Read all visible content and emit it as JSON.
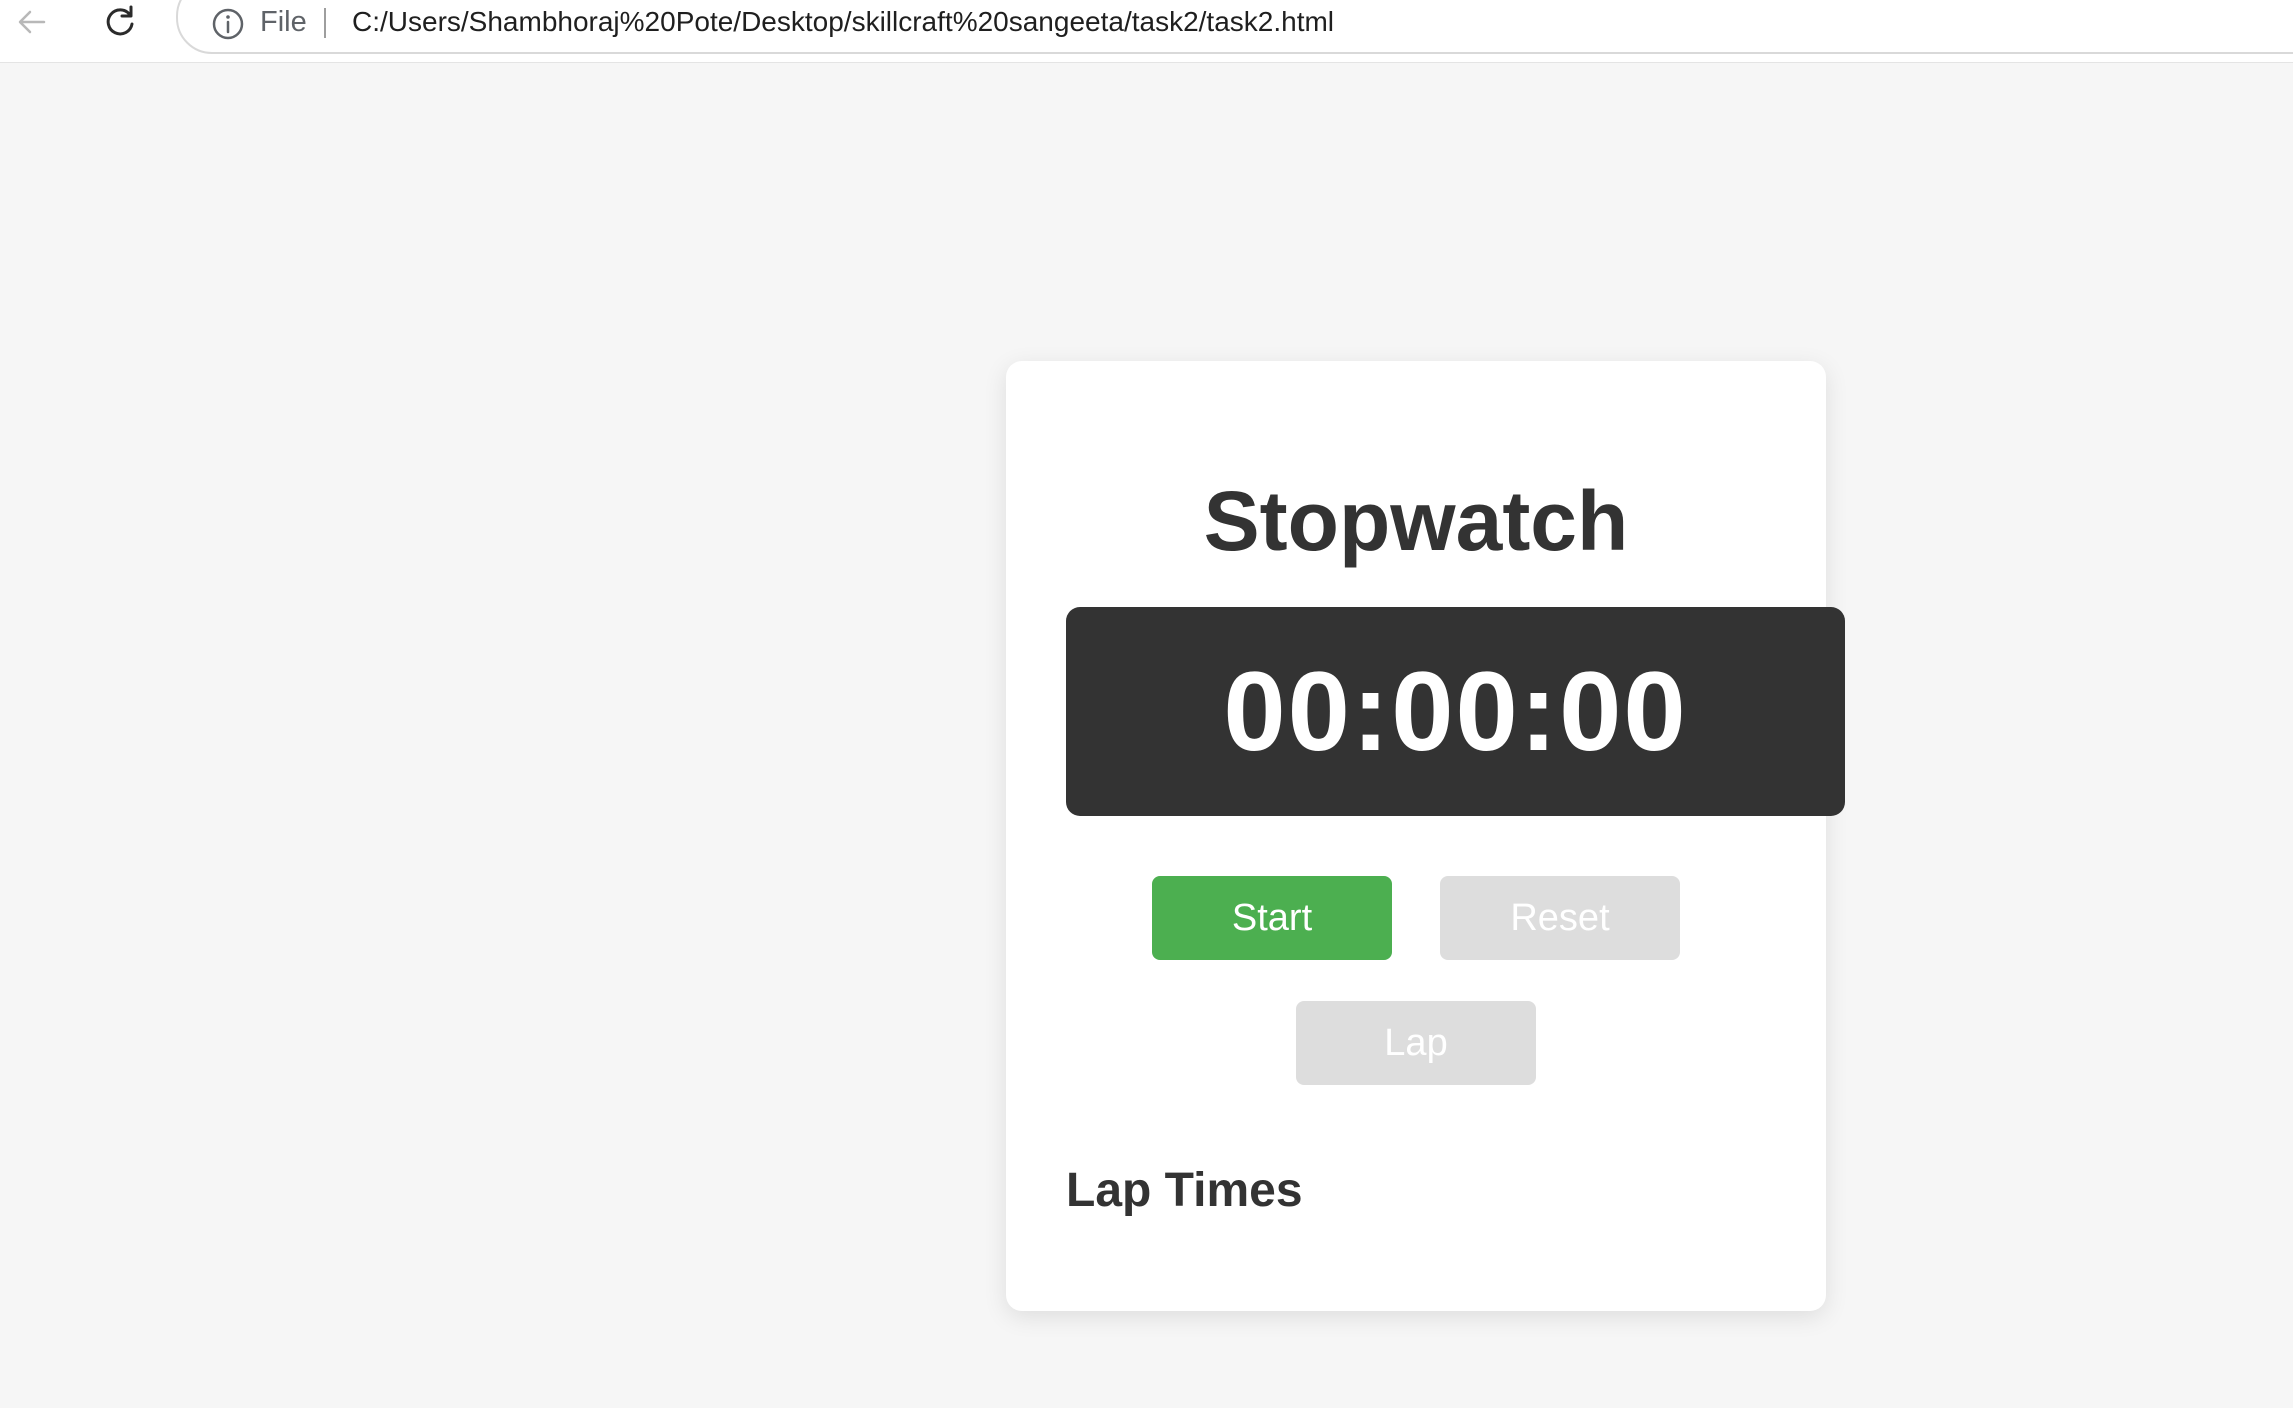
{
  "browser": {
    "file_label": "File",
    "url": "C:/Users/Shambhoraj%20Pote/Desktop/skillcraft%20sangeeta/task2/task2.html"
  },
  "stopwatch": {
    "title": "Stopwatch",
    "time": "00:00:00",
    "buttons": {
      "start": "Start",
      "reset": "Reset",
      "lap": "Lap"
    },
    "lap_heading": "Lap Times",
    "laps": []
  },
  "colors": {
    "start_button": "#4caf50",
    "disabled_button": "#dddddd",
    "display_background": "#333333",
    "page_background": "#f6f6f6"
  }
}
